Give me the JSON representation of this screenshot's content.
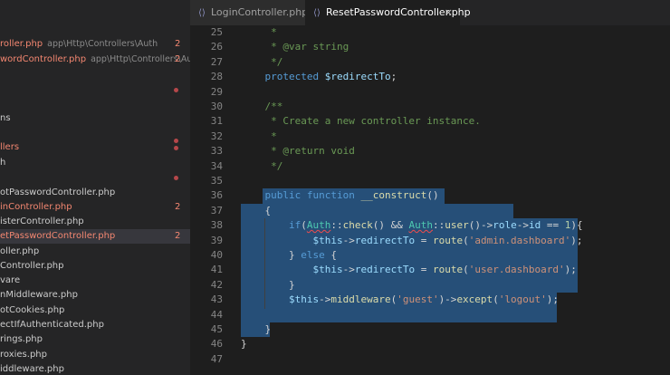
{
  "tabs": [
    {
      "label": "LoginController.php",
      "icon": "php-file-icon"
    },
    {
      "label": "ResetPasswordController.php",
      "icon": "php-file-icon",
      "close": "×"
    }
  ],
  "sidebar": {
    "rows": [
      {
        "name": "roller.php",
        "path": "app\\Http\\Controllers\\Auth",
        "badge": "2",
        "error": true
      },
      {
        "name": "wordController.php",
        "path": "app\\Http\\Controllers\\Auth",
        "badge": "2",
        "error": true
      },
      {
        "name": "",
        "dot": true
      },
      {
        "name": ""
      },
      {
        "name": "ns"
      },
      {
        "name": "",
        "dot": true
      },
      {
        "name": "llers",
        "error": true,
        "dot": true
      },
      {
        "name": "h"
      },
      {
        "name": "",
        "dot": true
      },
      {
        "name": "otPasswordController.php"
      },
      {
        "name": "inController.php",
        "badge": "2",
        "error": true
      },
      {
        "name": "isterController.php"
      },
      {
        "name": "etPasswordController.php",
        "badge": "2",
        "error": true,
        "active": true
      },
      {
        "name": "oller.php"
      },
      {
        "name": "Controller.php"
      },
      {
        "name": "vare"
      },
      {
        "name": "nMiddleware.php"
      },
      {
        "name": "otCookies.php"
      },
      {
        "name": "ectIfAuthenticated.php"
      },
      {
        "name": "rings.php"
      },
      {
        "name": "roxies.php"
      },
      {
        "name": "iddleware.php"
      }
    ]
  },
  "editor": {
    "lines": [
      {
        "n": "25",
        "t": [
          {
            "c": "c-com",
            "s": "     *"
          }
        ]
      },
      {
        "n": "26",
        "t": [
          {
            "c": "c-com",
            "s": "     * @var string"
          }
        ]
      },
      {
        "n": "27",
        "t": [
          {
            "c": "c-com",
            "s": "     */"
          }
        ]
      },
      {
        "n": "28",
        "t": [
          {
            "c": "c-kw",
            "s": "    protected "
          },
          {
            "c": "c-var",
            "s": "$redirectTo"
          },
          {
            "c": "c-op",
            "s": ";"
          }
        ]
      },
      {
        "n": "29",
        "t": []
      },
      {
        "n": "30",
        "t": [
          {
            "c": "c-com",
            "s": "    /**"
          }
        ]
      },
      {
        "n": "31",
        "t": [
          {
            "c": "c-com",
            "s": "     * Create a new controller instance."
          }
        ]
      },
      {
        "n": "32",
        "t": [
          {
            "c": "c-com",
            "s": "     *"
          }
        ]
      },
      {
        "n": "33",
        "t": [
          {
            "c": "c-com",
            "s": "     * @return void"
          }
        ]
      },
      {
        "n": "34",
        "t": [
          {
            "c": "c-com",
            "s": "     */"
          }
        ]
      },
      {
        "n": "35",
        "t": []
      },
      {
        "n": "36",
        "t": [
          {
            "c": "c-op",
            "s": "    "
          },
          {
            "c": "c-kw",
            "s": "public function "
          },
          {
            "c": "c-fn",
            "s": "__construct"
          },
          {
            "c": "c-op",
            "s": "()"
          }
        ]
      },
      {
        "n": "37",
        "t": [
          {
            "c": "c-op",
            "s": "    {"
          }
        ]
      },
      {
        "n": "38",
        "t": [
          {
            "c": "c-kw",
            "s": "        if"
          },
          {
            "c": "c-op",
            "s": "("
          },
          {
            "c": "c-cls squiggle",
            "s": "Auth"
          },
          {
            "c": "c-op",
            "s": "::"
          },
          {
            "c": "c-fn",
            "s": "check"
          },
          {
            "c": "c-op",
            "s": "() && "
          },
          {
            "c": "c-cls squiggle",
            "s": "Auth"
          },
          {
            "c": "c-op",
            "s": "::"
          },
          {
            "c": "c-fn",
            "s": "user"
          },
          {
            "c": "c-op",
            "s": "()->"
          },
          {
            "c": "c-var",
            "s": "role"
          },
          {
            "c": "c-op",
            "s": "->"
          },
          {
            "c": "c-var",
            "s": "id"
          },
          {
            "c": "c-op",
            "s": " == "
          },
          {
            "c": "c-num",
            "s": "1"
          },
          {
            "c": "c-op",
            "s": "){"
          }
        ]
      },
      {
        "n": "39",
        "t": [
          {
            "c": "c-var",
            "s": "            $this"
          },
          {
            "c": "c-op",
            "s": "->"
          },
          {
            "c": "c-var",
            "s": "redirectTo"
          },
          {
            "c": "c-op",
            "s": " = "
          },
          {
            "c": "c-fn",
            "s": "route"
          },
          {
            "c": "c-op",
            "s": "("
          },
          {
            "c": "c-str",
            "s": "'admin.dashboard'"
          },
          {
            "c": "c-op",
            "s": ");"
          }
        ]
      },
      {
        "n": "40",
        "t": [
          {
            "c": "c-op",
            "s": "        } "
          },
          {
            "c": "c-kw",
            "s": "else"
          },
          {
            "c": "c-op",
            "s": " {"
          }
        ]
      },
      {
        "n": "41",
        "t": [
          {
            "c": "c-var",
            "s": "            $this"
          },
          {
            "c": "c-op",
            "s": "->"
          },
          {
            "c": "c-var",
            "s": "redirectTo"
          },
          {
            "c": "c-op",
            "s": " = "
          },
          {
            "c": "c-fn",
            "s": "route"
          },
          {
            "c": "c-op",
            "s": "("
          },
          {
            "c": "c-str",
            "s": "'user.dashboard'"
          },
          {
            "c": "c-op",
            "s": ");"
          }
        ]
      },
      {
        "n": "42",
        "t": [
          {
            "c": "c-op",
            "s": "        }"
          }
        ]
      },
      {
        "n": "43",
        "t": [
          {
            "c": "c-var",
            "s": "        $this"
          },
          {
            "c": "c-op",
            "s": "->"
          },
          {
            "c": "c-fn",
            "s": "middleware"
          },
          {
            "c": "c-op",
            "s": "("
          },
          {
            "c": "c-str",
            "s": "'guest'"
          },
          {
            "c": "c-op",
            "s": ")->"
          },
          {
            "c": "c-fn",
            "s": "except"
          },
          {
            "c": "c-op",
            "s": "("
          },
          {
            "c": "c-str",
            "s": "'logout'"
          },
          {
            "c": "c-op",
            "s": ");"
          }
        ]
      },
      {
        "n": "44",
        "t": []
      },
      {
        "n": "45",
        "t": [
          {
            "c": "c-op",
            "s": "    }"
          }
        ]
      },
      {
        "n": "46",
        "t": [
          {
            "c": "c-op",
            "s": "}"
          }
        ]
      },
      {
        "n": "47",
        "t": []
      }
    ]
  }
}
